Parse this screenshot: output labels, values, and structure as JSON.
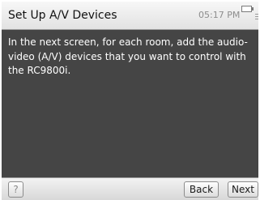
{
  "header": {
    "title": "Set Up A/V Devices",
    "time": "05:17 PM"
  },
  "main": {
    "message": "In the next screen, for each room, add the audio-video (A/V) devices that you want to control with the RC9800i."
  },
  "footer": {
    "help_label": "?",
    "back_label": "Back",
    "next_label": "Next"
  },
  "colors": {
    "content_background": "#454545",
    "content_text": "#ffffff"
  }
}
